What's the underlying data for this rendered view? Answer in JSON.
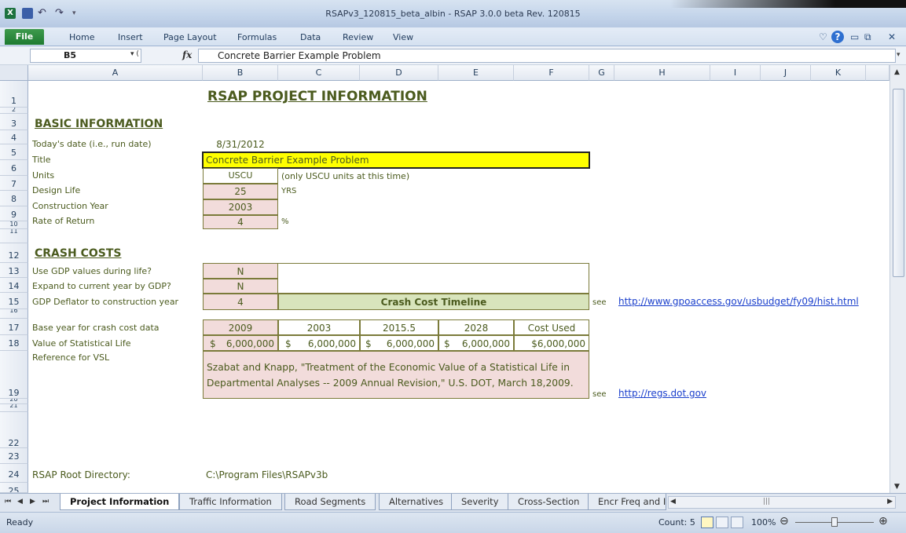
{
  "window": {
    "title": "RSAPv3_120815_beta_albin  -  RSAP 3.0.0 beta Rev. 120815"
  },
  "ribbon": {
    "tabs": [
      "File",
      "Home",
      "Insert",
      "Page Layout",
      "Formulas",
      "Data",
      "Review",
      "View"
    ]
  },
  "formula_bar": {
    "name_box": "B5",
    "fx": "fx",
    "content": "Concrete Barrier Example Problem"
  },
  "columns": [
    "A",
    "B",
    "C",
    "D",
    "E",
    "F",
    "G",
    "H",
    "I",
    "J",
    "K"
  ],
  "rows": [
    "1",
    "2",
    "3",
    "4",
    "5",
    "6",
    "7",
    "8",
    "9",
    "10",
    "11",
    "12",
    "13",
    "14",
    "15",
    "16",
    "17",
    "18",
    "19",
    "20",
    "21",
    "22",
    "23",
    "24",
    "25"
  ],
  "sheet": {
    "page_title": "RSAP PROJECT INFORMATION",
    "basic_header": "BASIC INFORMATION",
    "labels": {
      "todays_date": "Today's date (i.e., run date)",
      "title": "Title",
      "units": "Units",
      "design_life": "Design Life",
      "construction_year": "Construction Year",
      "rate_of_return": "Rate of Return"
    },
    "values": {
      "todays_date": "8/31/2012",
      "title": "Concrete Barrier Example Problem",
      "units": "USCU",
      "units_note": "(only USCU units at this time)",
      "design_life": "25",
      "design_life_unit": "YRS",
      "construction_year": "2003",
      "rate_of_return": "4",
      "rate_unit": "%"
    },
    "crash_header": "CRASH COSTS",
    "crash_labels": {
      "use_gdp": "Use GDP values during life?",
      "expand": "Expand to current year by GDP?",
      "deflator": "GDP Deflator to construction year",
      "base_year": "Base year for crash cost data",
      "vsl": "Value of Statistical Life",
      "ref_vsl": "Reference for VSL"
    },
    "crash_values": {
      "use_gdp": "N",
      "expand": "N",
      "deflator": "4",
      "timeline_title": "Crash Cost Timeline",
      "see": "see",
      "link1": "http://www.gpoaccess.gov/usbudget/fy09/hist.html",
      "base_years": [
        "2009",
        "2003",
        "2015.5",
        "2028",
        "Cost Used"
      ],
      "dollar": "$",
      "vsl_values": [
        "6,000,000",
        "6,000,000",
        "6,000,000",
        "6,000,000"
      ],
      "cost_used": "$6,000,000",
      "reference_line1": "Szabat and Knapp, \"Treatment of the Economic Value of a Statistical Life in",
      "reference_line2": "Departmental Analyses -- 2009 Annual Revision,\" U.S. DOT, March 18,2009.",
      "link2": "http://regs.dot.gov"
    },
    "root_dir_label": "RSAP Root Directory:",
    "root_dir_value": "C:\\Program Files\\RSAPv3b"
  },
  "sheet_tabs": [
    "Project Information",
    "Traffic Information",
    "Road Segments",
    "Alternatives",
    "Severity",
    "Cross-Section",
    "Encr Freq and I"
  ],
  "status": {
    "ready": "Ready",
    "count": "Count: 5",
    "zoom": "100%"
  }
}
